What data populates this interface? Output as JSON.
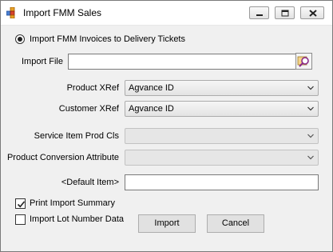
{
  "window": {
    "title": "Import FMM Sales"
  },
  "import_option": {
    "label": "Import FMM Invoices to Delivery Tickets",
    "selected": true
  },
  "import_file": {
    "label": "Import File",
    "value": ""
  },
  "product_xref": {
    "label": "Product XRef",
    "value": "Agvance ID"
  },
  "customer_xref": {
    "label": "Customer XRef",
    "value": "Agvance ID"
  },
  "service_item_prod_cls": {
    "label": "Service Item Prod Cls",
    "value": ""
  },
  "product_conversion_attribute": {
    "label": "Product Conversion Attribute",
    "value": ""
  },
  "default_item": {
    "label": "<Default Item>",
    "value": ""
  },
  "print_import_summary": {
    "label": "Print Import Summary",
    "checked": true
  },
  "import_lot_number_data": {
    "label": "Import Lot Number Data",
    "checked": false
  },
  "buttons": {
    "import": "Import",
    "cancel": "Cancel"
  }
}
